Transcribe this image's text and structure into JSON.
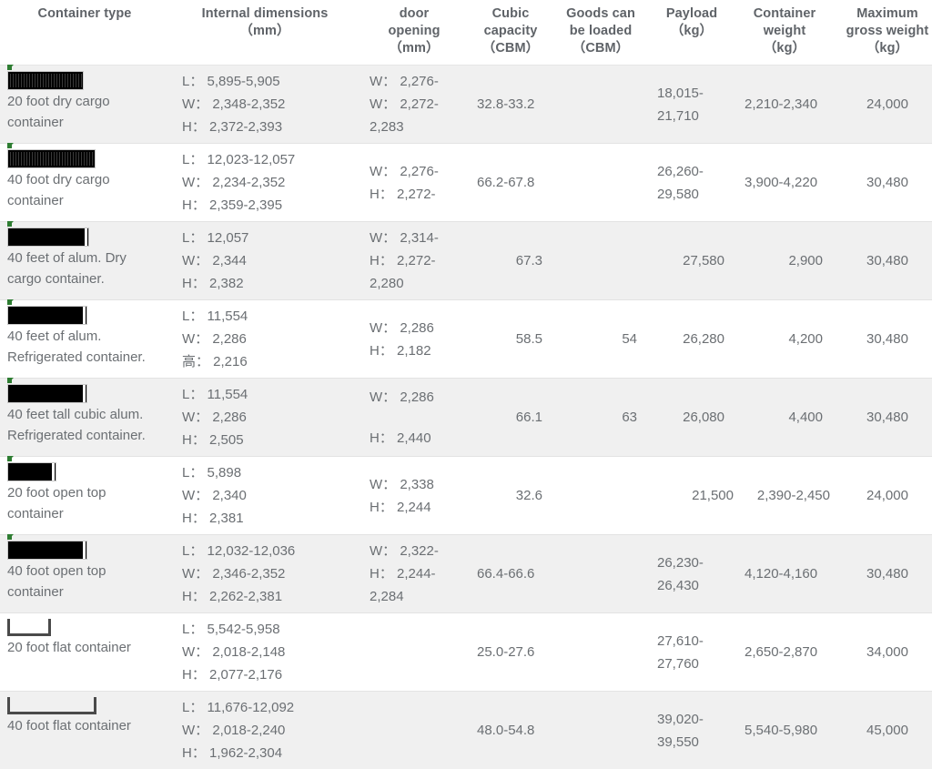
{
  "table": {
    "headers": [
      {
        "key": "container_type",
        "lines": [
          "Container type"
        ]
      },
      {
        "key": "internal_dimensions",
        "lines": [
          "Internal dimensions",
          "（mm）"
        ]
      },
      {
        "key": "door_opening",
        "lines": [
          "door",
          "opening",
          "（mm）"
        ]
      },
      {
        "key": "cubic_capacity",
        "lines": [
          "Cubic",
          "capacity",
          "（CBM）"
        ]
      },
      {
        "key": "goods_can_be_loaded",
        "lines": [
          "Goods can",
          "be loaded",
          "（CBM）"
        ]
      },
      {
        "key": "payload",
        "lines": [
          "Payload",
          "（kg）"
        ]
      },
      {
        "key": "container_weight",
        "lines": [
          "Container",
          "weight",
          "（kg）"
        ]
      },
      {
        "key": "maximum_gross_weight",
        "lines": [
          "Maximum",
          "gross weight",
          "（kg）"
        ]
      }
    ],
    "rows": [
      {
        "icon": "container-dry-20ft-icon",
        "type_line1": "20 foot dry cargo",
        "type_line2": "container",
        "internal": [
          "L：  5,895-5,905",
          "W：  2,348-2,352",
          "H：  2,372-2,393"
        ],
        "door": [
          "W：  2,276-",
          "W：  2,272-",
          "2,283"
        ],
        "cubic": "32.8-33.2",
        "goods": "",
        "payload": "18,015-\n21,710",
        "payload_l1": "18,015-",
        "payload_l2": "21,710",
        "container_weight": "2,210-2,340",
        "gross_weight": "24,000"
      },
      {
        "icon": "container-dry-40ft-icon",
        "type_line1": "40 foot dry cargo",
        "type_line2": "container",
        "internal": [
          "L：  12,023-12,057",
          "W：  2,234-2,352",
          "H：  2,359-2,395"
        ],
        "door": [
          "W：  2,276-",
          "H：  2,272-"
        ],
        "cubic": "66.2-67.8",
        "goods": "",
        "payload_l1": "26,260-",
        "payload_l2": "29,580",
        "container_weight": "3,900-4,220",
        "gross_weight": "30,480"
      },
      {
        "icon": "container-alum-dry-40ft-icon",
        "type_line1": "40 feet of alum. Dry",
        "type_line2": "cargo container.",
        "internal": [
          "L：  12,057",
          "W：  2,344",
          "H：  2,382"
        ],
        "door": [
          "W：  2,314-",
          "H：  2,272-",
          "2,280"
        ],
        "cubic": "67.3",
        "goods": "",
        "payload_l1": "27,580",
        "payload_l2": "",
        "container_weight": "2,900",
        "gross_weight": "30,480"
      },
      {
        "icon": "container-alum-reefer-40ft-icon",
        "type_line1": "40 feet of alum.",
        "type_line2": "Refrigerated container.",
        "internal": [
          "L：  11,554",
          "W：  2,286",
          "高：  2,216"
        ],
        "door": [
          "W：  2,286",
          "H：  2,182"
        ],
        "cubic": "58.5",
        "goods": "54",
        "payload_l1": "26,280",
        "payload_l2": "",
        "container_weight": "4,200",
        "gross_weight": "30,480"
      },
      {
        "icon": "container-alum-reefer-hc-40ft-icon",
        "type_line1": "40 feet tall cubic alum.",
        "type_line2": "Refrigerated container.",
        "internal": [
          "L：  11,554",
          "W：  2,286",
          "H：  2,505"
        ],
        "door": [
          "W：  2,286",
          "H：  2,440"
        ],
        "cubic": "66.1",
        "goods": "63",
        "payload_l1": "26,080",
        "payload_l2": "",
        "container_weight": "4,400",
        "gross_weight": "30,480"
      },
      {
        "icon": "container-open-top-20ft-icon",
        "type_line1": "20 foot open top",
        "type_line2": "container",
        "internal": [
          "L：  5,898",
          "W：  2,340",
          "H：  2,381"
        ],
        "door": [
          "W：  2,338",
          "H：  2,244"
        ],
        "cubic": "32.6",
        "goods": "",
        "payload_l1": "21,500",
        "payload_l2": "",
        "container_weight": "2,390-2,450",
        "gross_weight": "24,000"
      },
      {
        "icon": "container-open-top-40ft-icon",
        "type_line1": "40 foot open top",
        "type_line2": "container",
        "internal": [
          "L：  12,032-12,036",
          "W：  2,346-2,352",
          "H：  2,262-2,381"
        ],
        "door": [
          "W：  2,322-",
          "H：  2,244-",
          "2,284"
        ],
        "cubic": "66.4-66.6",
        "goods": "",
        "payload_l1": "26,230-",
        "payload_l2": "26,430",
        "container_weight": "4,120-4,160",
        "gross_weight": "30,480"
      },
      {
        "icon": "container-flat-rack-20ft-icon",
        "type_line1": "20 foot flat container",
        "type_line2": "",
        "internal": [
          "L：  5,542-5,958",
          "W：  2,018-2,148",
          "H：  2,077-2,176"
        ],
        "door": [],
        "cubic": "25.0-27.6",
        "goods": "",
        "payload_l1": "27,610-",
        "payload_l2": "27,760",
        "container_weight": "2,650-2,870",
        "gross_weight": "34,000"
      },
      {
        "icon": "container-flat-rack-40ft-icon",
        "type_line1": "40 foot flat container",
        "type_line2": "",
        "internal": [
          "L：  11,676-12,092",
          "W：  2,018-2,240",
          "H：  1,962-2,304"
        ],
        "door": [],
        "cubic": "48.0-54.8",
        "goods": "",
        "payload_l1": "39,020-",
        "payload_l2": "39,550",
        "container_weight": "5,540-5,980",
        "gross_weight": "45,000"
      }
    ]
  },
  "colors": {
    "text": "#6b6f73",
    "header_text": "#5f6368",
    "row_shade": "#f0f0f0",
    "row_plain": "#ffffff",
    "divider": "#e3e3e3",
    "icon_marker": "#2e7d32"
  }
}
